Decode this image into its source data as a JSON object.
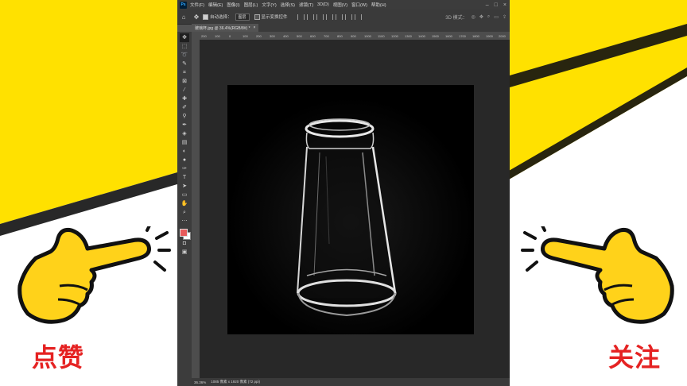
{
  "menu": {
    "app_icon": "Ps",
    "items": [
      "文件(F)",
      "编辑(E)",
      "图像(I)",
      "图层(L)",
      "文字(Y)",
      "选择(S)",
      "滤镜(T)",
      "3D(D)",
      "视图(V)",
      "窗口(W)",
      "帮助(H)"
    ]
  },
  "options": {
    "auto_select_label": "自动选择：",
    "auto_select_value": "图层",
    "transform_label": "显示变换控件",
    "mode_3d": "3D 模式："
  },
  "tools": [
    "move-icon",
    "marquee-icon",
    "lasso-icon",
    "quick-select-icon",
    "crop-icon",
    "frame-icon",
    "eyedropper-icon",
    "healing-icon",
    "brush-icon",
    "stamp-icon",
    "history-brush-icon",
    "eraser-icon",
    "gradient-icon",
    "blur-icon",
    "dodge-icon",
    "pen-icon",
    "type-icon",
    "path-select-icon",
    "rectangle-icon",
    "hand-icon",
    "zoom-icon",
    "more-icon"
  ],
  "colors": {
    "foreground": "#e85a5a",
    "background": "#ffffff",
    "cta_red": "#e52222",
    "yellow": "#ffe100"
  },
  "document": {
    "tab_title": "玻璃杯.jpg @ 36.4%(RGB/8#) *",
    "close": "×"
  },
  "ruler": {
    "ticks": [
      "200",
      "100",
      "0",
      "100",
      "200",
      "300",
      "400",
      "500",
      "600",
      "700",
      "800",
      "900",
      "1000",
      "1100",
      "1200",
      "1300",
      "1400",
      "1500",
      "1600",
      "1700",
      "1800",
      "1900",
      "2000"
    ]
  },
  "status": {
    "zoom": "36.36%",
    "doc_info": "1085 像素 x 1920 像素 (72 ppi)"
  },
  "cta": {
    "left": "点赞",
    "right": "关注"
  }
}
